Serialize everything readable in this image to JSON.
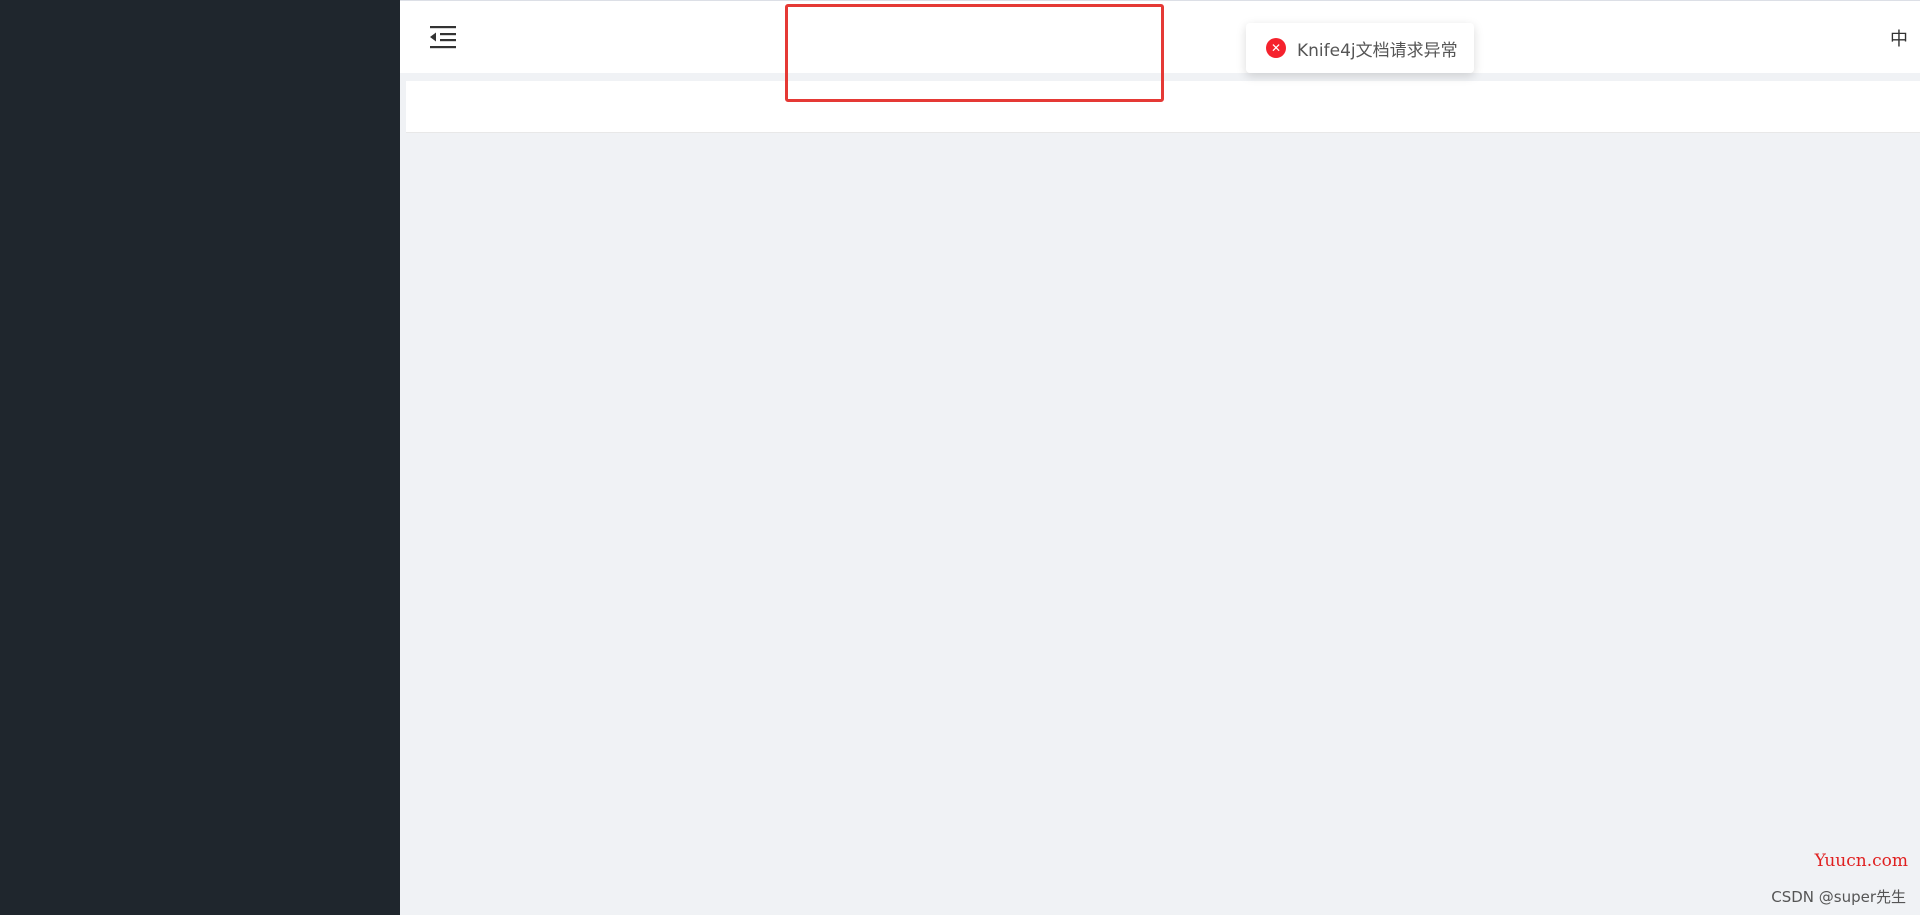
{
  "header": {
    "language_toggle": "中"
  },
  "toast": {
    "message": "Knife4j文档请求异常",
    "icon": "error-circle-icon",
    "icon_glyph": "✕",
    "icon_color": "#f5222d"
  },
  "watermarks": {
    "site": "Yuucn.com",
    "csdn": "CSDN @super先生"
  },
  "colors": {
    "sidebar": "#1f262d",
    "background": "#f0f2f5",
    "highlight": "#e53935"
  }
}
